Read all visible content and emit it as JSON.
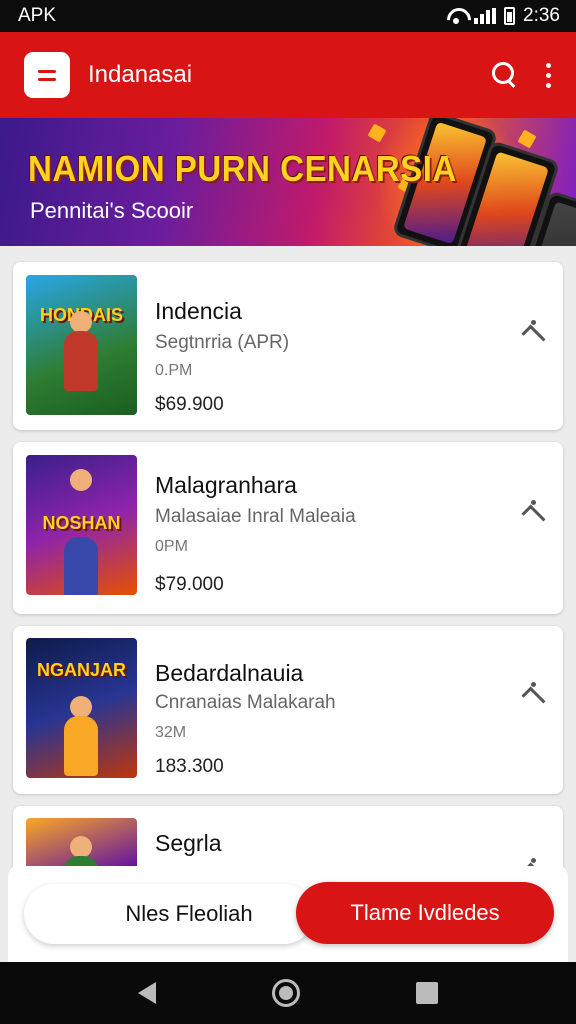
{
  "status_bar": {
    "carrier": "APK",
    "time": "2:36"
  },
  "app_bar": {
    "title": "Indanasai"
  },
  "banner": {
    "headline": "NAMION PURN CENARSIA",
    "subline": "Pennitai's Scooir"
  },
  "apps": [
    {
      "thumb_text": "HONDAIS",
      "name": "Indencia",
      "subtitle": "Segtnrria (APR)",
      "size": "0.PM",
      "price": "$69.900"
    },
    {
      "thumb_text": "NOSHAN",
      "name": "Malagranhara",
      "subtitle": "Malasaiae Inral Maleaia",
      "size": "0PM",
      "price": "$79.000"
    },
    {
      "thumb_text": "NGANJAR",
      "name": "Bedardalnauia",
      "subtitle": "Cnranaias Malakarah",
      "size": "32M",
      "price": "183.300"
    },
    {
      "thumb_text": "",
      "name": "Segrla",
      "subtitle": "",
      "size": "",
      "price": ""
    }
  ],
  "actions": {
    "secondary_label": "Nles Fleoliah",
    "primary_label": "Tlame Ivdledes"
  },
  "colors": {
    "accent": "#d81414",
    "banner_text": "#ffd21f"
  },
  "icons": [
    "menu-icon",
    "search-icon",
    "more-vert-icon",
    "download-icon",
    "back-icon",
    "home-icon",
    "recents-icon"
  ]
}
